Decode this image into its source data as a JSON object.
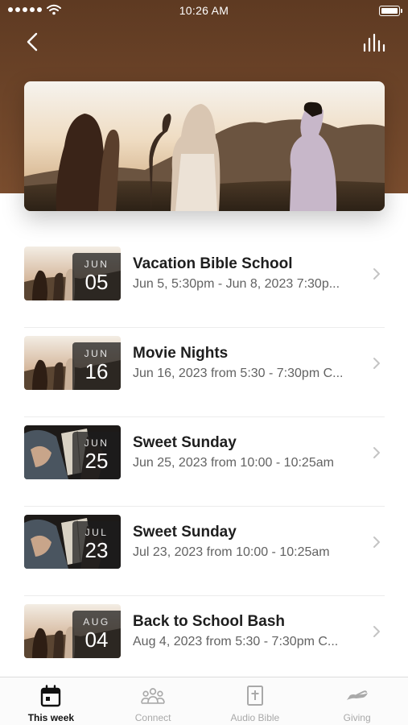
{
  "status_bar": {
    "time": "10:26 AM"
  },
  "header": {
    "back_icon": "chevron-left-icon",
    "audio_icon": "audio-levels-icon"
  },
  "colors": {
    "header_brown": "#6e4529",
    "tab_active": "#111111",
    "tab_inactive": "#a9a9a9"
  },
  "events": [
    {
      "month": "JUN",
      "day": "05",
      "title": "Vacation Bible School",
      "subtitle": "Jun 5, 5:30pm - Jun 8, 2023 7:30p...",
      "thumb": "group-sunset"
    },
    {
      "month": "JUN",
      "day": "16",
      "title": "Movie Nights",
      "subtitle": "Jun 16, 2023 from 5:30 - 7:30pm C...",
      "thumb": "group-sunset"
    },
    {
      "month": "JUN",
      "day": "25",
      "title": "Sweet Sunday",
      "subtitle": "Jun 25, 2023 from 10:00 - 10:25am",
      "thumb": "bible-reading"
    },
    {
      "month": "JUL",
      "day": "23",
      "title": "Sweet Sunday",
      "subtitle": "Jul 23, 2023 from 10:00 - 10:25am",
      "thumb": "bible-reading"
    },
    {
      "month": "AUG",
      "day": "04",
      "title": "Back to School Bash",
      "subtitle": "Aug 4, 2023 from 5:30 - 7:30pm C...",
      "thumb": "group-sunset"
    }
  ],
  "tabs": [
    {
      "label": "This week",
      "icon": "calendar-icon",
      "active": true
    },
    {
      "label": "Connect",
      "icon": "people-icon",
      "active": false
    },
    {
      "label": "Audio Bible",
      "icon": "bible-icon",
      "active": false
    },
    {
      "label": "Giving",
      "icon": "giving-hand-icon",
      "active": false
    }
  ]
}
